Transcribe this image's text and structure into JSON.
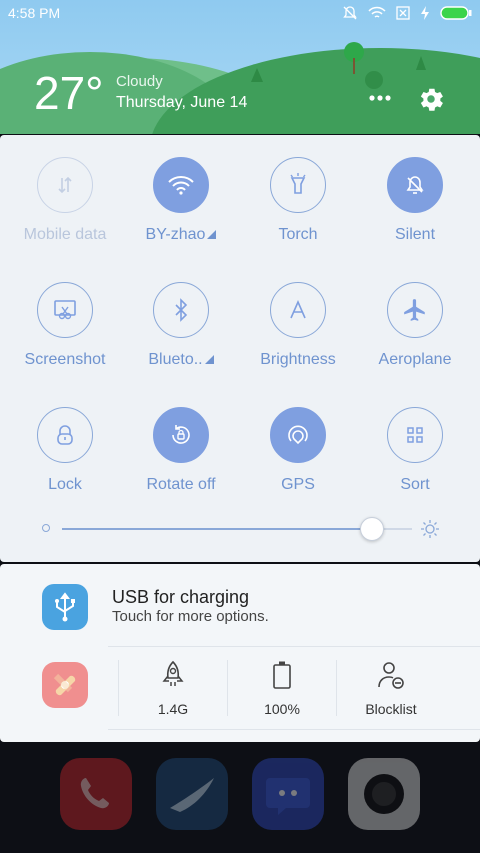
{
  "status_bar": {
    "time": "4:58 PM"
  },
  "weather": {
    "temperature": "27°",
    "condition": "Cloudy",
    "date": "Thursday, June 14"
  },
  "tiles": [
    {
      "label": "Mobile data",
      "icon": "mobile-data-icon",
      "state": "disabled"
    },
    {
      "label": "BY-zhao",
      "icon": "wifi-icon",
      "state": "on",
      "expand": true
    },
    {
      "label": "Torch",
      "icon": "torch-icon",
      "state": "off"
    },
    {
      "label": "Silent",
      "icon": "silent-icon",
      "state": "on"
    },
    {
      "label": "Screenshot",
      "icon": "screenshot-icon",
      "state": "off"
    },
    {
      "label": "Blueto..",
      "icon": "bluetooth-icon",
      "state": "off",
      "expand": true
    },
    {
      "label": "Brightness",
      "icon": "brightness-icon",
      "state": "off"
    },
    {
      "label": "Aeroplane",
      "icon": "aeroplane-icon",
      "state": "off"
    },
    {
      "label": "Lock",
      "icon": "lock-icon",
      "state": "off"
    },
    {
      "label": "Rotate off",
      "icon": "rotate-icon",
      "state": "on"
    },
    {
      "label": "GPS",
      "icon": "gps-icon",
      "state": "on"
    },
    {
      "label": "Sort",
      "icon": "sort-icon",
      "state": "off"
    }
  ],
  "brightness": {
    "level": 0.9
  },
  "notification": {
    "title": "USB for charging",
    "subtitle": "Touch for more options."
  },
  "shortcuts": [
    {
      "label": "1.4G",
      "icon": "rocket-icon"
    },
    {
      "label": "100%",
      "icon": "battery-icon"
    },
    {
      "label": "Blocklist",
      "icon": "blocklist-icon"
    }
  ],
  "colors": {
    "accent": "#7f9fe0",
    "header_sky": "#a9d8f4",
    "hill": "#3f9e5a",
    "usb_icon": "#4aa3e0"
  }
}
